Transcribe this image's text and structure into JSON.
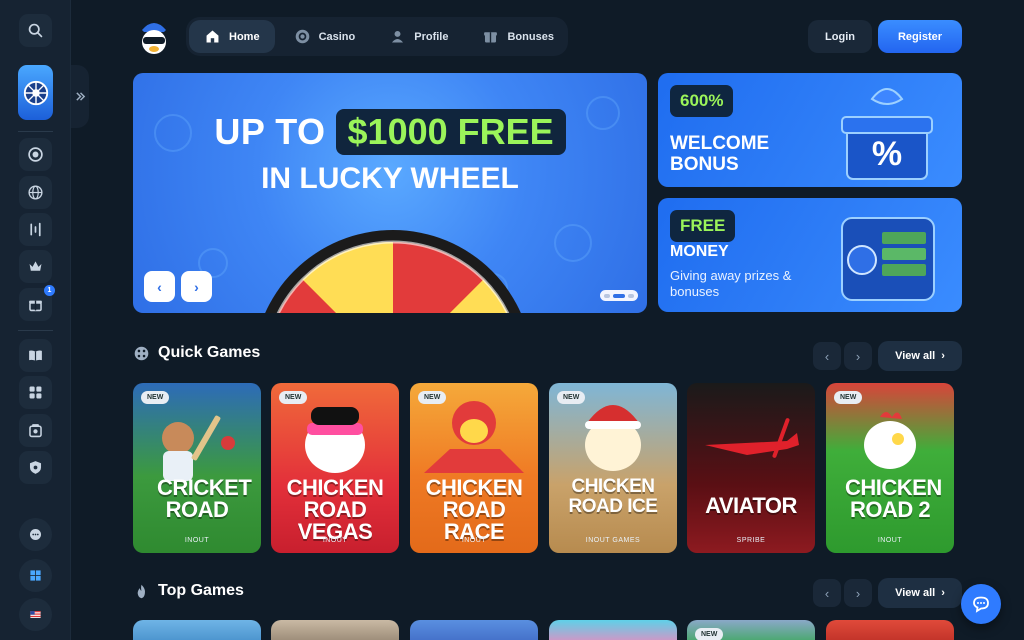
{
  "nav": {
    "items": [
      {
        "label": "Home",
        "icon": "home-icon",
        "active": true
      },
      {
        "label": "Casino",
        "icon": "chip-icon",
        "active": false
      },
      {
        "label": "Profile",
        "icon": "user-icon",
        "active": false
      },
      {
        "label": "Bonuses",
        "icon": "gift-icon",
        "active": false
      }
    ]
  },
  "auth": {
    "login": "Login",
    "register": "Register"
  },
  "sidebar": {
    "icons": [
      "search-icon",
      "promo-wheel-icon",
      "casino-chip-icon",
      "globe-icon",
      "live-games-icon",
      "crown-icon",
      "gift-icon",
      "book-icon",
      "tournament-icon",
      "vault-icon",
      "shield-icon",
      "support-chat-icon",
      "windows-icon",
      "flag-us-icon"
    ],
    "gift_badge": "1"
  },
  "hero": {
    "line1_prefix": "UP TO",
    "amount": "$1000 FREE",
    "line2": "IN LUCKY WHEEL",
    "prev_label": "‹",
    "next_label": "›"
  },
  "promos": [
    {
      "chip": "600%",
      "title": "WELCOME BONUS"
    },
    {
      "chip": "FREE",
      "title": "MONEY",
      "subtitle": "Giving away prizes & bonuses"
    }
  ],
  "sections": {
    "quick": {
      "title": "Quick Games",
      "view_all": "View all"
    },
    "top": {
      "title": "Top Games",
      "view_all": "View all"
    }
  },
  "quick_games": [
    {
      "title": "CRICKET ROAD",
      "provider": "INOUT",
      "badge": "NEW"
    },
    {
      "title": "CHICKEN ROAD VEGAS",
      "provider": "INOUT",
      "badge": "NEW"
    },
    {
      "title": "CHICKEN ROAD RACE",
      "provider": "INOUT",
      "badge": "NEW"
    },
    {
      "title": "CHICKEN ROAD ICE",
      "provider": "INOUT GAMES",
      "badge": "NEW"
    },
    {
      "title": "AVIATOR",
      "provider": "SPRIBE",
      "badge": ""
    },
    {
      "title": "CHICKEN ROAD 2",
      "provider": "INOUT",
      "badge": "NEW"
    }
  ],
  "top_games_badge": "NEW",
  "colors": {
    "bg": "#0f1b27",
    "panel": "#162332",
    "accent": "#2f7bff",
    "lime": "#9bf45a"
  }
}
